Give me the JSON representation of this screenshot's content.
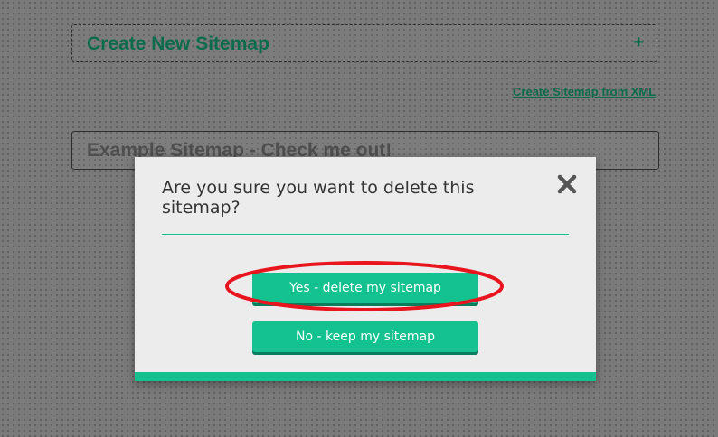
{
  "page": {
    "create_panel": {
      "title": "Create New Sitemap",
      "expand_icon": "plus-icon",
      "expand_symbol": "+"
    },
    "xml_link": "Create Sitemap from XML",
    "sitemap_item": "Example Sitemap - Check me out!"
  },
  "modal": {
    "question": "Are you sure you want to delete this sitemap?",
    "close_icon": "close-icon",
    "confirm_button": "Yes - delete my sitemap",
    "cancel_button": "No - keep my sitemap"
  },
  "annotation": {
    "highlight": "red-ellipse around confirm button"
  },
  "colors": {
    "accent": "#13c28f",
    "accent_dark": "#0a7e5c",
    "title_green": "#0c6b4c",
    "highlight_red": "#e8141e",
    "modal_bg": "#ececec"
  }
}
